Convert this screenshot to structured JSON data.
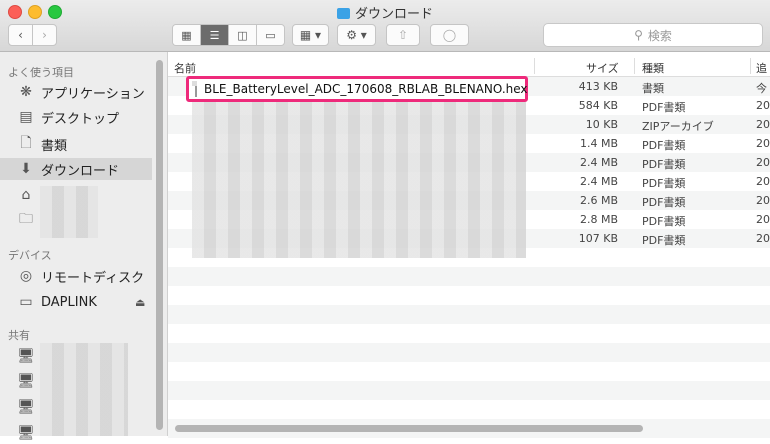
{
  "window": {
    "title": "ダウンロード"
  },
  "toolbar": {
    "back_icon": "chevron-left-icon",
    "forward_icon": "chevron-right-icon",
    "search_placeholder": "検索"
  },
  "sidebar": {
    "favorites_header": "よく使う項目",
    "favorites": [
      {
        "label": "アプリケーション",
        "icon": "applications-icon"
      },
      {
        "label": "デスクトップ",
        "icon": "desktop-icon"
      },
      {
        "label": "書類",
        "icon": "documents-icon"
      },
      {
        "label": "ダウンロード",
        "icon": "downloads-icon",
        "selected": true
      }
    ],
    "devices_header": "デバイス",
    "devices": [
      {
        "label": "リモートディスク",
        "icon": "disc-icon"
      },
      {
        "label": "DAPLINK",
        "icon": "drive-icon"
      }
    ],
    "shared_header": "共有"
  },
  "columns": {
    "name": "名前",
    "size": "サイズ",
    "kind": "種類",
    "added": "追加"
  },
  "files": [
    {
      "name": "BLE_BatteryLevel_ADC_170608_RBLAB_BLENANO.hex",
      "size": "413 KB",
      "kind": "書類",
      "added": "今"
    },
    {
      "size": "584 KB",
      "kind": "PDF書類",
      "added": "20"
    },
    {
      "size": "10 KB",
      "kind": "ZIPアーカイブ",
      "added": "20"
    },
    {
      "size": "1.4 MB",
      "kind": "PDF書類",
      "added": "20"
    },
    {
      "size": "2.4 MB",
      "kind": "PDF書類",
      "added": "20"
    },
    {
      "size": "2.4 MB",
      "kind": "PDF書類",
      "added": "20"
    },
    {
      "size": "2.6 MB",
      "kind": "PDF書類",
      "added": "20"
    },
    {
      "size": "2.8 MB",
      "kind": "PDF書類",
      "added": "20"
    },
    {
      "size": "107 KB",
      "kind": "PDF書類",
      "added": "20"
    }
  ],
  "colors": {
    "highlight": "#ee2a7b",
    "selected_sidebar": "#d6d6d6"
  }
}
